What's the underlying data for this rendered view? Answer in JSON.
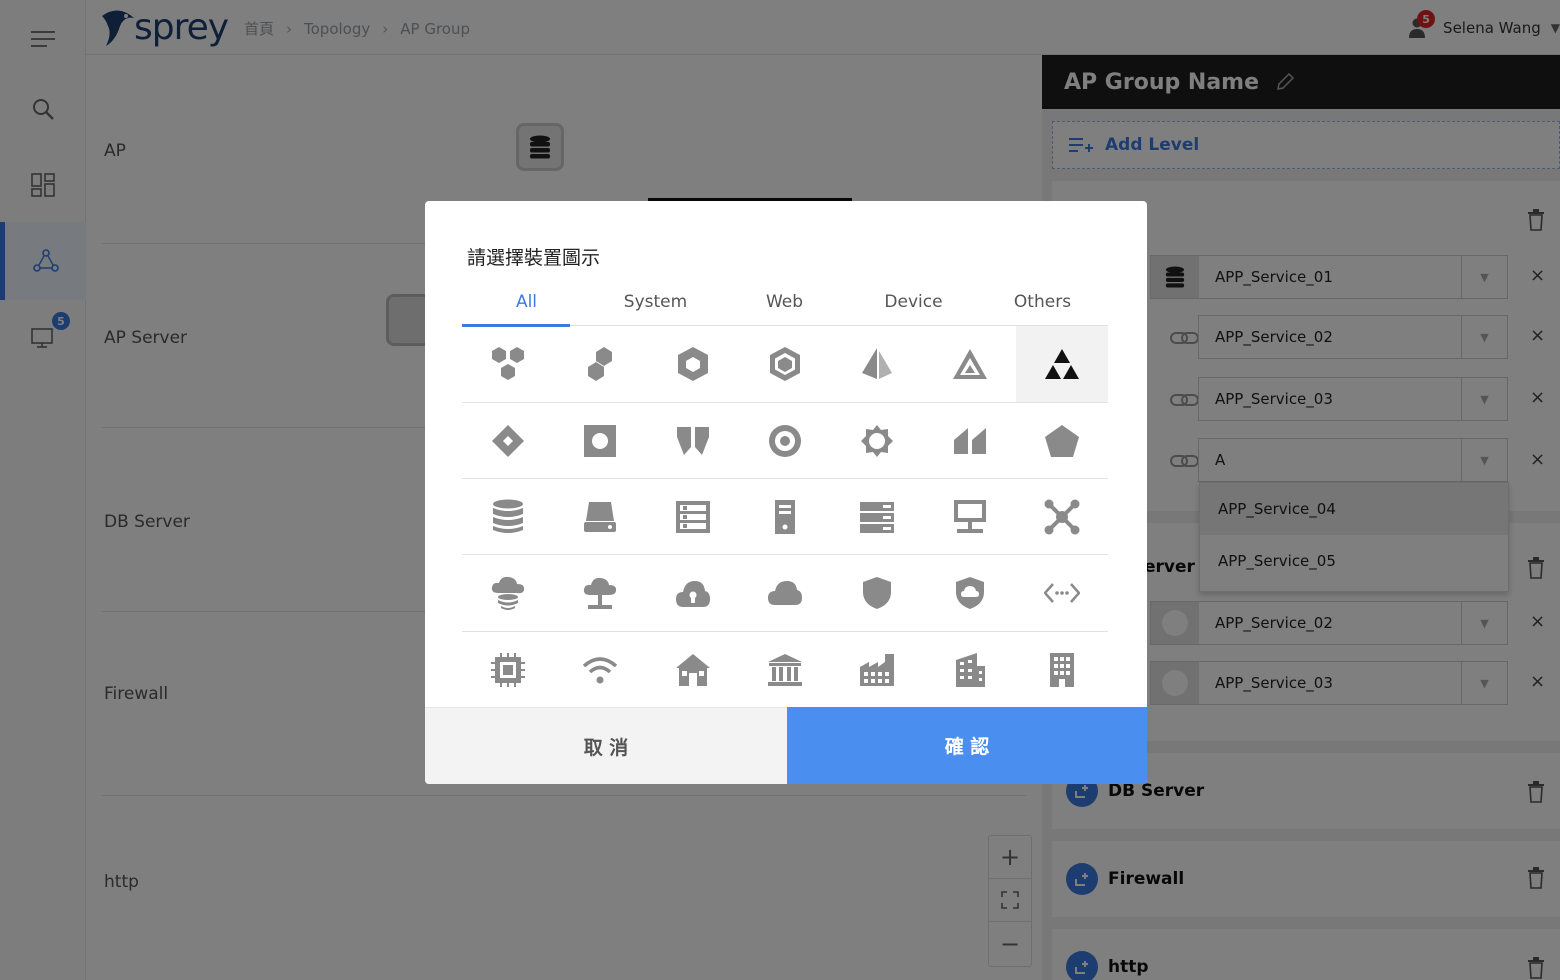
{
  "app": {
    "logo_text": "sprey",
    "breadcrumb": [
      "首頁",
      "Topology",
      "AP Group"
    ],
    "user_name": "Selena Wang",
    "user_badge": "5",
    "sidebar_badge": "5"
  },
  "canvas": {
    "levels": [
      "AP",
      "AP Server",
      "DB Server",
      "Firewall",
      "http"
    ]
  },
  "panel": {
    "title": "AP Group Name",
    "add_level": "Add Level",
    "level1_services": [
      "APP_Service_01",
      "APP_Service_02",
      "APP_Service_03",
      "A"
    ],
    "dropdown_options": [
      "APP_Service_04",
      "APP_Service_05"
    ],
    "level2_title_fragment": "erver",
    "level2_services": [
      "APP_Service_02",
      "APP_Service_03"
    ],
    "level3_title": "DB Server",
    "level4_title": "Firewall",
    "level5_title": "http"
  },
  "modal": {
    "title": "請選擇裝置圖示",
    "tabs": [
      "All",
      "System",
      "Web",
      "Device",
      "Others"
    ],
    "active_tab": "All",
    "icon_rows": [
      [
        "hexagon-cluster-icon",
        "hexagon-pair-icon",
        "hexagon-solid-icon",
        "hexagon-outline-icon",
        "pyramid-icon",
        "triangle-outline-icon",
        "triforce-icon"
      ],
      [
        "diamond-icon",
        "square-dot-icon",
        "shield-split-icon",
        "target-circle-icon",
        "gear-badge-icon",
        "parallelogram-pair-icon",
        "pentagon-icon"
      ],
      [
        "database-icon",
        "hard-drive-icon",
        "server-rack-icon",
        "server-tower-icon",
        "server-blade-icon",
        "monitor-network-icon",
        "network-hub-icon"
      ],
      [
        "cloud-database-icon",
        "cloud-network-icon",
        "cloud-lock-icon",
        "cloud-icon",
        "shield-icon",
        "shield-cloud-icon",
        "code-arrows-icon"
      ],
      [
        "chip-icon",
        "wifi-icon",
        "house-icon",
        "bank-icon",
        "factory-icon",
        "building-icon",
        "office-tower-icon"
      ]
    ],
    "selected_icon": "triforce-icon",
    "cancel": "取 消",
    "confirm": "確 認"
  },
  "colors": {
    "accent": "#3a7be0",
    "confirm_button": "#4a8ff0",
    "badge_red": "#e02424",
    "panel_header": "#1e1e1e",
    "icon_gray": "#8a8a8a"
  }
}
